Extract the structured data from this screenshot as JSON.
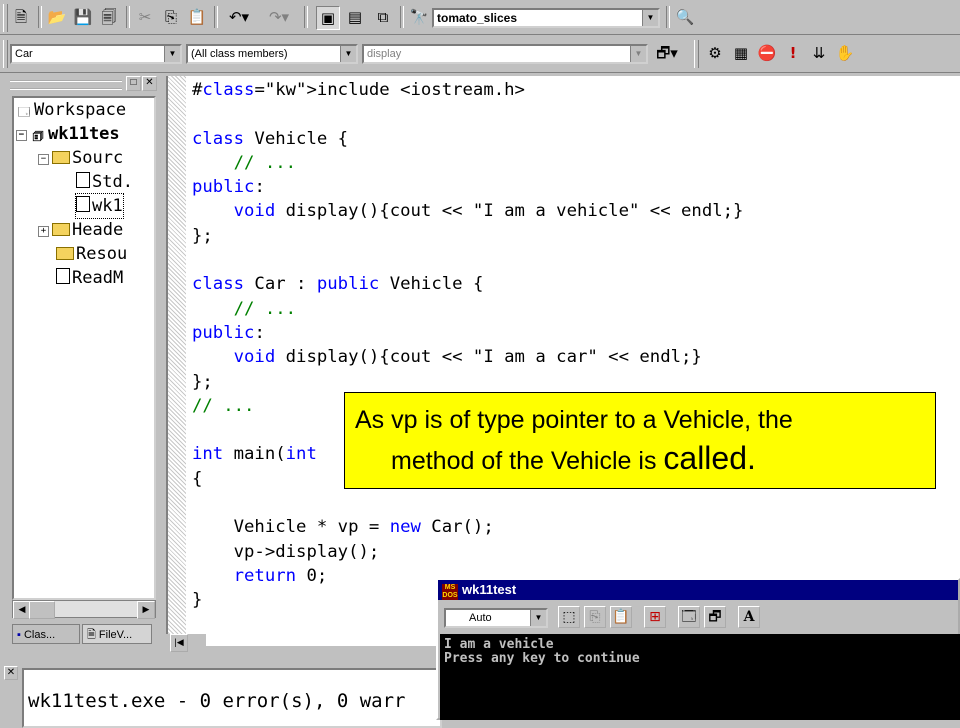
{
  "toolbar": {
    "project_combo": "tomato_slices",
    "class_combo": "Car",
    "filter_combo": "(All class members)",
    "member_combo": "display"
  },
  "workspace": {
    "items": [
      {
        "label": "Workspace"
      },
      {
        "label": "wk11tes"
      },
      {
        "label": "Sourc"
      },
      {
        "label": "Std."
      },
      {
        "label": "wk1"
      },
      {
        "label": "Heade"
      },
      {
        "label": "Resou"
      },
      {
        "label": "ReadM"
      }
    ],
    "tabs": [
      "Clas...",
      "FileV..."
    ]
  },
  "editor": {
    "lines": [
      {
        "t": "#include <iostream.h>"
      },
      {
        "t": ""
      },
      {
        "t": "class Vehicle {"
      },
      {
        "t": "    // ..."
      },
      {
        "t": "public:"
      },
      {
        "t": "    void display(){cout << \"I am a vehicle\" << endl;}"
      },
      {
        "t": "};"
      },
      {
        "t": ""
      },
      {
        "t": "class Car : public Vehicle {"
      },
      {
        "t": "    // ..."
      },
      {
        "t": "public:"
      },
      {
        "t": "    void display(){cout << \"I am a car\" << endl;}"
      },
      {
        "t": "};"
      },
      {
        "t": "// ..."
      },
      {
        "t": ""
      },
      {
        "t": "int main(int"
      },
      {
        "t": "{"
      },
      {
        "t": ""
      },
      {
        "t": "    Vehicle * vp = new Car();"
      },
      {
        "t": "    vp->display();"
      },
      {
        "t": "    return 0;"
      },
      {
        "t": "}"
      }
    ]
  },
  "callout": {
    "line1": "As vp is of type pointer to a Vehicle, the",
    "line2": "method of the Vehicle is ",
    "line2_big": "called."
  },
  "output": {
    "text": "wk11test.exe - 0 error(s), 0 warr"
  },
  "console": {
    "title": "wk11test",
    "font_combo": "Auto",
    "lines": [
      "I am a vehicle",
      "Press any key to continue"
    ]
  },
  "colors": {
    "keyword": "#0000ff",
    "comment": "#008000",
    "callout_bg": "#ffff00",
    "titlebar": "#000080"
  }
}
